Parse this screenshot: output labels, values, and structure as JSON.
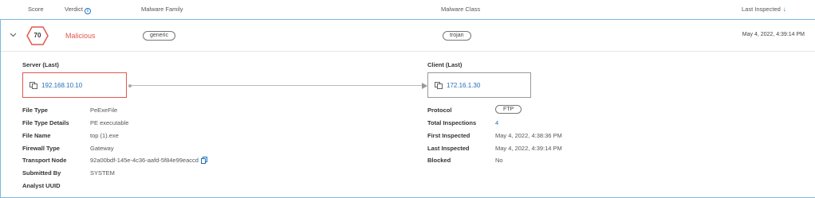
{
  "header": {
    "score": "Score",
    "verdict": "Verdict",
    "malware_family": "Malware Family",
    "malware_class": "Malware Class",
    "last_inspected": "Last Inspected"
  },
  "row": {
    "score": "70",
    "verdict": "Malicious",
    "malware_family": "generic",
    "malware_class": "trojan",
    "last_inspected": "May 4, 2022, 4:39:14 PM"
  },
  "server": {
    "label": "Server (Last)",
    "ip": "192.168.10.10"
  },
  "client": {
    "label": "Client (Last)",
    "ip": "172.16.1.30"
  },
  "details_left": {
    "file_type_label": "File Type",
    "file_type": "PeExeFile",
    "file_type_details_label": "File Type Details",
    "file_type_details": "PE executable",
    "file_name_label": "File Name",
    "file_name": "top (1).exe",
    "firewall_type_label": "Firewall Type",
    "firewall_type": "Gateway",
    "transport_node_label": "Transport Node",
    "transport_node": "92a00bdf-145e-4c36-aafd-5f84e99eaccd",
    "submitted_by_label": "Submitted By",
    "submitted_by": "SYSTEM",
    "analyst_uuid_label": "Analyst UUID",
    "analyst_uuid": ""
  },
  "details_right": {
    "protocol_label": "Protocol",
    "protocol": "FTP",
    "total_inspections_label": "Total Inspections",
    "total_inspections": "4",
    "first_inspected_label": "First Inspected",
    "first_inspected": "May 4, 2022, 4:38:36 PM",
    "last_inspected_label": "Last Inspected",
    "last_inspected": "May 4, 2022, 4:39:14 PM",
    "blocked_label": "Blocked",
    "blocked": "No"
  },
  "colors": {
    "malicious": "#e0584f",
    "accent": "#1e6fb8",
    "row_border": "#7ab7dd"
  },
  "icons": {
    "info": "info-icon",
    "sort": "sort-down-arrow-icon",
    "chevron": "chevron-down-icon",
    "node": "server-node-icon",
    "copy": "copy-icon"
  }
}
